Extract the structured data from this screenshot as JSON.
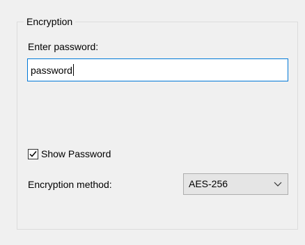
{
  "encryption": {
    "group_title": "Encryption",
    "password_label": "Enter password:",
    "password_value": "password",
    "show_password_label": "Show Password",
    "show_password_checked": true,
    "method_label": "Encryption method:",
    "method_value": "AES-256"
  },
  "icons": {
    "checkbox": "checkmark-icon",
    "dropdown": "chevron-down-icon"
  },
  "colors": {
    "accent": "#0078d7",
    "window_bg": "#f0f0f0"
  }
}
